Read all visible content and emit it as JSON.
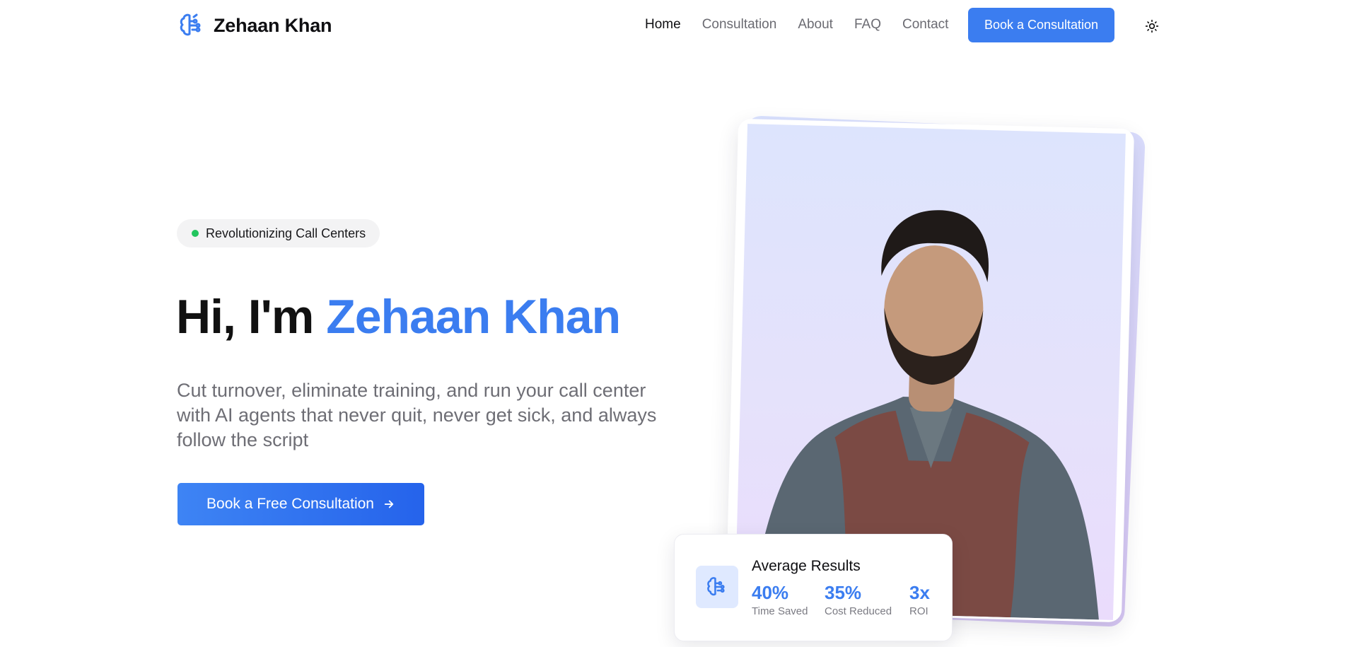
{
  "header": {
    "brand": "Zehaan Khan",
    "logo_icon": "brain-icon",
    "nav": [
      {
        "label": "Home",
        "active": true
      },
      {
        "label": "Consultation",
        "active": false
      },
      {
        "label": "About",
        "active": false
      },
      {
        "label": "FAQ",
        "active": false
      },
      {
        "label": "Contact",
        "active": false
      }
    ],
    "cta_label": "Book a Consultation",
    "theme_icon": "sun-icon"
  },
  "hero": {
    "badge": "Revolutionizing Call Centers",
    "title_prefix": "Hi, I'm ",
    "title_name": "Zehaan Khan",
    "subtitle": "Cut turnover, eliminate training, and run your call center with AI agents that never quit, never get sick, and always follow the script",
    "cta_label": "Book a Free Consultation",
    "cta_icon": "arrow-right-icon"
  },
  "results": {
    "title": "Average Results",
    "icon": "brain-icon",
    "stats": [
      {
        "value": "40%",
        "label": "Time Saved"
      },
      {
        "value": "35%",
        "label": "Cost Reduced"
      },
      {
        "value": "3x",
        "label": "ROI"
      }
    ]
  },
  "colors": {
    "accent": "#3b7df0",
    "badge_dot": "#22c55e",
    "text_muted": "#6e6e75"
  }
}
